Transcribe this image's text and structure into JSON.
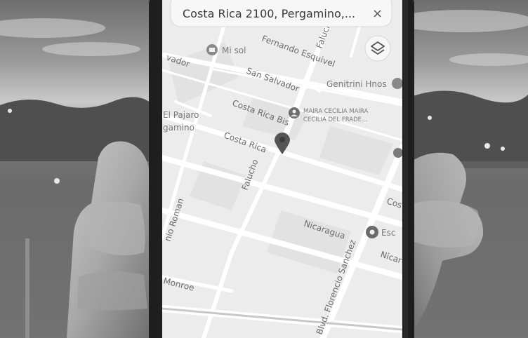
{
  "search": {
    "query": "Costa Rica 2100, Pergamino,...",
    "close_glyph": "×"
  },
  "map": {
    "streets": {
      "fernando_esquivel": "Fernando Esquivel",
      "falucho_top": "Falucho",
      "salvador": "vador",
      "san_salvador": "San Salvador",
      "costa_rica_bis": "Costa Rica Bis",
      "costa_rica": "Costa Rica",
      "falucho": "Falucho",
      "nicaragua": "Nicaragua",
      "nicar": "Nicar",
      "florencio_sanchez": "Blvd. Florencio Sanchez",
      "roman": "nio Roman",
      "monroe": "Monroe",
      "cos": "Cos"
    },
    "pois": {
      "mi_sol": "Mi sol",
      "genitrini": "Genitrini Hnos",
      "el_pajaro": "El Pajaro",
      "gamino": "gamino",
      "maira_1": "MAIRA CECILIA MAIRA",
      "maira_2": "CECILIA DEL FRADE...",
      "esc": "Esc"
    }
  },
  "icons": [
    "layers-icon",
    "close-icon",
    "location-pin-icon",
    "place-icon",
    "person-icon"
  ]
}
